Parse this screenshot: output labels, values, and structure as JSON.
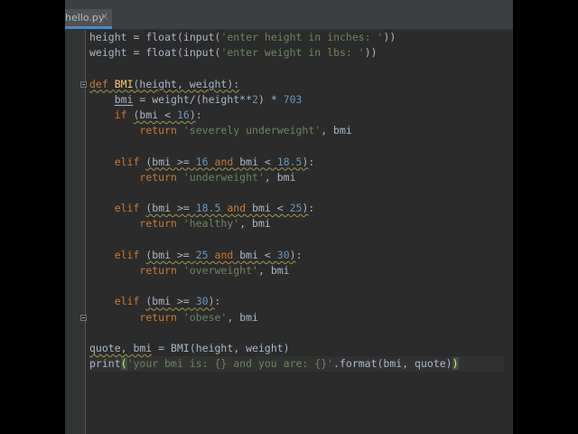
{
  "tab": {
    "name": "hello.py",
    "close": "✕"
  },
  "code": [
    {
      "tokens": [
        [
          "height",
          "id"
        ],
        [
          " = ",
          "op"
        ],
        [
          "float",
          "id"
        ],
        [
          "(",
          "p"
        ],
        [
          "input",
          "id"
        ],
        [
          "(",
          "p"
        ],
        [
          "'enter height in inches: '",
          "str"
        ],
        [
          "))",
          "p"
        ]
      ]
    },
    {
      "tokens": [
        [
          "weight",
          "id"
        ],
        [
          " = ",
          "op"
        ],
        [
          "float",
          "id"
        ],
        [
          "(",
          "p"
        ],
        [
          "input",
          "id"
        ],
        [
          "(",
          "p"
        ],
        [
          "'enter weight in lbs: '",
          "str"
        ],
        [
          "))",
          "p"
        ]
      ]
    },
    {
      "tokens": []
    },
    {
      "fold": true,
      "tokens": [
        [
          "def",
          "kw wave"
        ],
        [
          " ",
          "p wave"
        ],
        [
          "BMI",
          "fn wave"
        ],
        [
          "(height, weight):",
          "p wave"
        ]
      ]
    },
    {
      "tokens": [
        [
          "    ",
          "p"
        ],
        [
          "bmi",
          "id ul"
        ],
        [
          " = weight/(height**",
          "op"
        ],
        [
          "2",
          "num"
        ],
        [
          ") * ",
          "op"
        ],
        [
          "703",
          "num"
        ]
      ]
    },
    {
      "tokens": [
        [
          "    ",
          "p"
        ],
        [
          "if",
          "kw"
        ],
        [
          " ",
          "p"
        ],
        [
          "(bmi < ",
          "p wave"
        ],
        [
          "16",
          "num wave"
        ],
        [
          ")",
          "p wave"
        ],
        [
          ":",
          "p"
        ]
      ]
    },
    {
      "tokens": [
        [
          "        ",
          "p"
        ],
        [
          "return",
          "kw"
        ],
        [
          " ",
          "p"
        ],
        [
          "'severely underweight'",
          "str"
        ],
        [
          ", bmi",
          "p"
        ]
      ]
    },
    {
      "tokens": []
    },
    {
      "tokens": [
        [
          "    ",
          "p"
        ],
        [
          "elif",
          "kw"
        ],
        [
          " ",
          "p"
        ],
        [
          "(bmi >= ",
          "p wave"
        ],
        [
          "16",
          "num wave"
        ],
        [
          " and ",
          "kw wave"
        ],
        [
          "bmi < ",
          "p wave"
        ],
        [
          "18.5",
          "num wave"
        ],
        [
          ")",
          "p wave"
        ],
        [
          ":",
          "p"
        ]
      ]
    },
    {
      "tokens": [
        [
          "        ",
          "p"
        ],
        [
          "return",
          "kw"
        ],
        [
          " ",
          "p"
        ],
        [
          "'underweight'",
          "str"
        ],
        [
          ", bmi",
          "p"
        ]
      ]
    },
    {
      "tokens": []
    },
    {
      "tokens": [
        [
          "    ",
          "p"
        ],
        [
          "elif",
          "kw"
        ],
        [
          " ",
          "p"
        ],
        [
          "(bmi >= ",
          "p wave"
        ],
        [
          "18.5",
          "num wave"
        ],
        [
          " and ",
          "kw wave"
        ],
        [
          "bmi < ",
          "p wave"
        ],
        [
          "25",
          "num wave"
        ],
        [
          ")",
          "p wave"
        ],
        [
          ":",
          "p"
        ]
      ]
    },
    {
      "tokens": [
        [
          "        ",
          "p"
        ],
        [
          "return",
          "kw"
        ],
        [
          " ",
          "p"
        ],
        [
          "'healthy'",
          "str"
        ],
        [
          ", bmi",
          "p"
        ]
      ]
    },
    {
      "tokens": []
    },
    {
      "tokens": [
        [
          "    ",
          "p"
        ],
        [
          "elif",
          "kw"
        ],
        [
          " ",
          "p"
        ],
        [
          "(bmi >= ",
          "p wave"
        ],
        [
          "25",
          "num wave"
        ],
        [
          " and ",
          "kw wave"
        ],
        [
          "bmi < ",
          "p wave"
        ],
        [
          "30",
          "num wave"
        ],
        [
          ")",
          "p wave"
        ],
        [
          ":",
          "p"
        ]
      ]
    },
    {
      "tokens": [
        [
          "        ",
          "p"
        ],
        [
          "return",
          "kw"
        ],
        [
          " ",
          "p"
        ],
        [
          "'overweight'",
          "str"
        ],
        [
          ", bmi",
          "p"
        ]
      ]
    },
    {
      "tokens": []
    },
    {
      "tokens": [
        [
          "    ",
          "p"
        ],
        [
          "elif",
          "kw"
        ],
        [
          " ",
          "p"
        ],
        [
          "(bmi >= ",
          "p wave"
        ],
        [
          "30",
          "num wave"
        ],
        [
          ")",
          "p wave"
        ],
        [
          ":",
          "p"
        ]
      ]
    },
    {
      "fold": true,
      "tokens": [
        [
          "        ",
          "p"
        ],
        [
          "return",
          "kw"
        ],
        [
          " ",
          "p"
        ],
        [
          "'obese'",
          "str"
        ],
        [
          ", bmi",
          "p"
        ]
      ]
    },
    {
      "tokens": []
    },
    {
      "tokens": [
        [
          "quote, bmi",
          "id wave"
        ],
        [
          " = ",
          "op"
        ],
        [
          "BMI",
          "id"
        ],
        [
          "(height, weight)",
          "p"
        ]
      ]
    },
    {
      "current": true,
      "tokens": [
        [
          "print",
          "id"
        ],
        [
          "(",
          "brk hl"
        ],
        [
          "'your bmi is: {} and you are: {}'",
          "str"
        ],
        [
          ".format(bmi, quote)",
          "p"
        ],
        [
          ")",
          "brk hl"
        ]
      ]
    }
  ],
  "colors": {
    "background": "#2b2b2b",
    "keyword": "#cc7832",
    "string": "#6a8759",
    "number": "#6897bb",
    "function": "#ffc66d",
    "text": "#a9b7c6"
  }
}
